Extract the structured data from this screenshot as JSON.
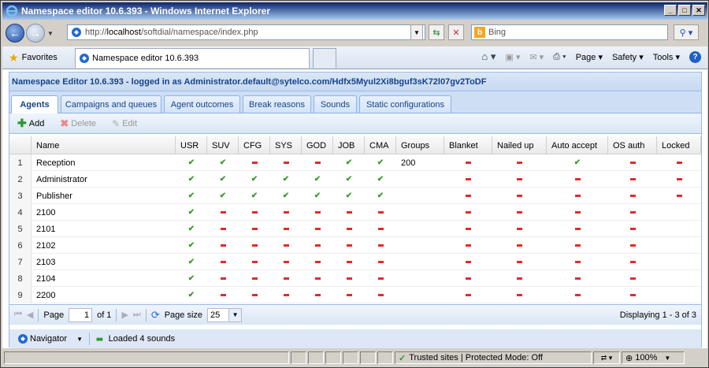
{
  "window": {
    "title": "Namespace editor 10.6.393 - Windows Internet Explorer"
  },
  "address": {
    "url_prefix": "http://",
    "url_host": "localhost",
    "url_path": "/softdial/namespace/index.php"
  },
  "search": {
    "placeholder": "Bing"
  },
  "favorites": {
    "label": "Favorites"
  },
  "browser_tab": {
    "title": "Namespace editor 10.6.393"
  },
  "commands": {
    "page": "Page",
    "safety": "Safety",
    "tools": "Tools"
  },
  "app": {
    "header": "Namespace Editor 10.6.393 - logged in as Administrator.default@sytelco.com/Hdfx5Myul2Xi8bguf3sK72l07gv2ToDF",
    "tabs": [
      "Agents",
      "Campaigns and queues",
      "Agent outcomes",
      "Break reasons",
      "Sounds",
      "Static configurations"
    ],
    "toolbar": {
      "add": "Add",
      "delete": "Delete",
      "edit": "Edit"
    }
  },
  "grid": {
    "columns": [
      "Name",
      "USR",
      "SUV",
      "CFG",
      "SYS",
      "GOD",
      "JOB",
      "CMA",
      "Groups",
      "Blanket",
      "Nailed up",
      "Auto accept",
      "OS auth",
      "Locked"
    ],
    "rows": [
      {
        "n": "1",
        "name": "Reception",
        "flags": [
          "y",
          "y",
          "n",
          "n",
          "n",
          "y",
          "y"
        ],
        "groups": "200",
        "blanket": "n",
        "nailed": "n",
        "auto": "y",
        "os": "n",
        "locked": "n"
      },
      {
        "n": "2",
        "name": "Administrator",
        "flags": [
          "y",
          "y",
          "y",
          "y",
          "y",
          "y",
          "y"
        ],
        "groups": "",
        "blanket": "n",
        "nailed": "n",
        "auto": "n",
        "os": "n",
        "locked": "n"
      },
      {
        "n": "3",
        "name": "Publisher",
        "flags": [
          "y",
          "y",
          "y",
          "y",
          "y",
          "y",
          "y"
        ],
        "groups": "",
        "blanket": "n",
        "nailed": "n",
        "auto": "n",
        "os": "n",
        "locked": "n"
      },
      {
        "n": "4",
        "name": "2100",
        "flags": [
          "y",
          "n",
          "n",
          "n",
          "n",
          "n",
          "n"
        ],
        "groups": "",
        "blanket": "n",
        "nailed": "n",
        "auto": "n",
        "os": "n",
        "locked": ""
      },
      {
        "n": "5",
        "name": "2101",
        "flags": [
          "y",
          "n",
          "n",
          "n",
          "n",
          "n",
          "n"
        ],
        "groups": "",
        "blanket": "n",
        "nailed": "n",
        "auto": "n",
        "os": "n",
        "locked": ""
      },
      {
        "n": "6",
        "name": "2102",
        "flags": [
          "y",
          "n",
          "n",
          "n",
          "n",
          "n",
          "n"
        ],
        "groups": "",
        "blanket": "n",
        "nailed": "n",
        "auto": "n",
        "os": "n",
        "locked": ""
      },
      {
        "n": "7",
        "name": "2103",
        "flags": [
          "y",
          "n",
          "n",
          "n",
          "n",
          "n",
          "n"
        ],
        "groups": "",
        "blanket": "n",
        "nailed": "n",
        "auto": "n",
        "os": "n",
        "locked": ""
      },
      {
        "n": "8",
        "name": "2104",
        "flags": [
          "y",
          "n",
          "n",
          "n",
          "n",
          "n",
          "n"
        ],
        "groups": "",
        "blanket": "n",
        "nailed": "n",
        "auto": "n",
        "os": "n",
        "locked": ""
      },
      {
        "n": "9",
        "name": "2200",
        "flags": [
          "y",
          "n",
          "n",
          "n",
          "n",
          "n",
          "n"
        ],
        "groups": "",
        "blanket": "n",
        "nailed": "n",
        "auto": "n",
        "os": "n",
        "locked": ""
      }
    ]
  },
  "pager": {
    "page_label": "Page",
    "page_value": "1",
    "of_label": "of 1",
    "size_label": "Page size",
    "size_value": "25",
    "displaying": "Displaying 1 - 3 of 3"
  },
  "footer": {
    "navigator": "Navigator",
    "status": "Loaded 4 sounds"
  },
  "statusbar": {
    "zone": "Trusted sites | Protected Mode: Off",
    "zoom": "100%"
  }
}
